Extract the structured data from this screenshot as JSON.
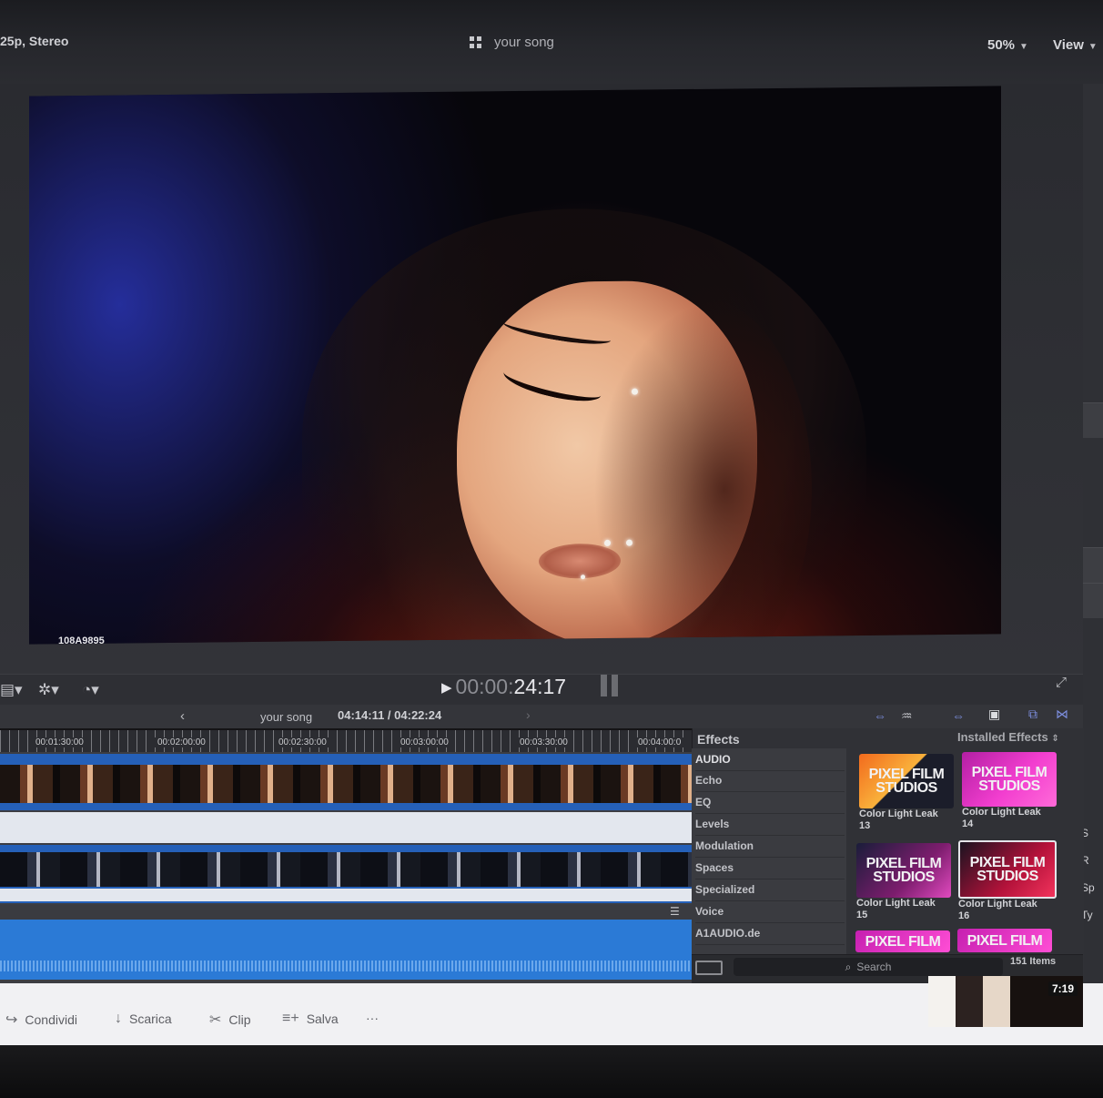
{
  "header": {
    "format": "25p, Stereo",
    "title": "your song",
    "zoom": "50%",
    "view_label": "View"
  },
  "viewer": {
    "clip_name": "108A9895"
  },
  "transport": {
    "timecode_dim": "00:00:",
    "timecode_main": "24:17"
  },
  "timeline": {
    "project": "your song",
    "duration": "04:14:11 / 04:22:24",
    "ruler": [
      "00:01:30:00",
      "00:02:00:00",
      "00:02:30:00",
      "00:03:00:00",
      "00:03:30:00",
      "00:04:00:0"
    ]
  },
  "effects": {
    "title": "Effects",
    "installed": "Installed Effects",
    "categories": [
      "AUDIO",
      "Echo",
      "EQ",
      "Levels",
      "Modulation",
      "Spaces",
      "Specialized",
      "Voice",
      "A1AUDIO.de"
    ],
    "thumb_text_1": "PIXEL FILM",
    "thumb_text_2": "STUDIOS",
    "items": [
      {
        "name": "Color Light Leak",
        "num": "13"
      },
      {
        "name": "Color Light Leak",
        "num": "14"
      },
      {
        "name": "Color Light Leak",
        "num": "15"
      },
      {
        "name": "Color Light Leak",
        "num": "16"
      }
    ],
    "search_placeholder": "Search",
    "count": "151 Items"
  },
  "browser_bar": {
    "share": "Condividi",
    "download": "Scarica",
    "clip": "Clip",
    "save": "Salva",
    "more": "···",
    "video_time": "7:19"
  },
  "right_panel": {
    "labels": [
      "S",
      "R",
      "Sp",
      "Ty"
    ]
  }
}
